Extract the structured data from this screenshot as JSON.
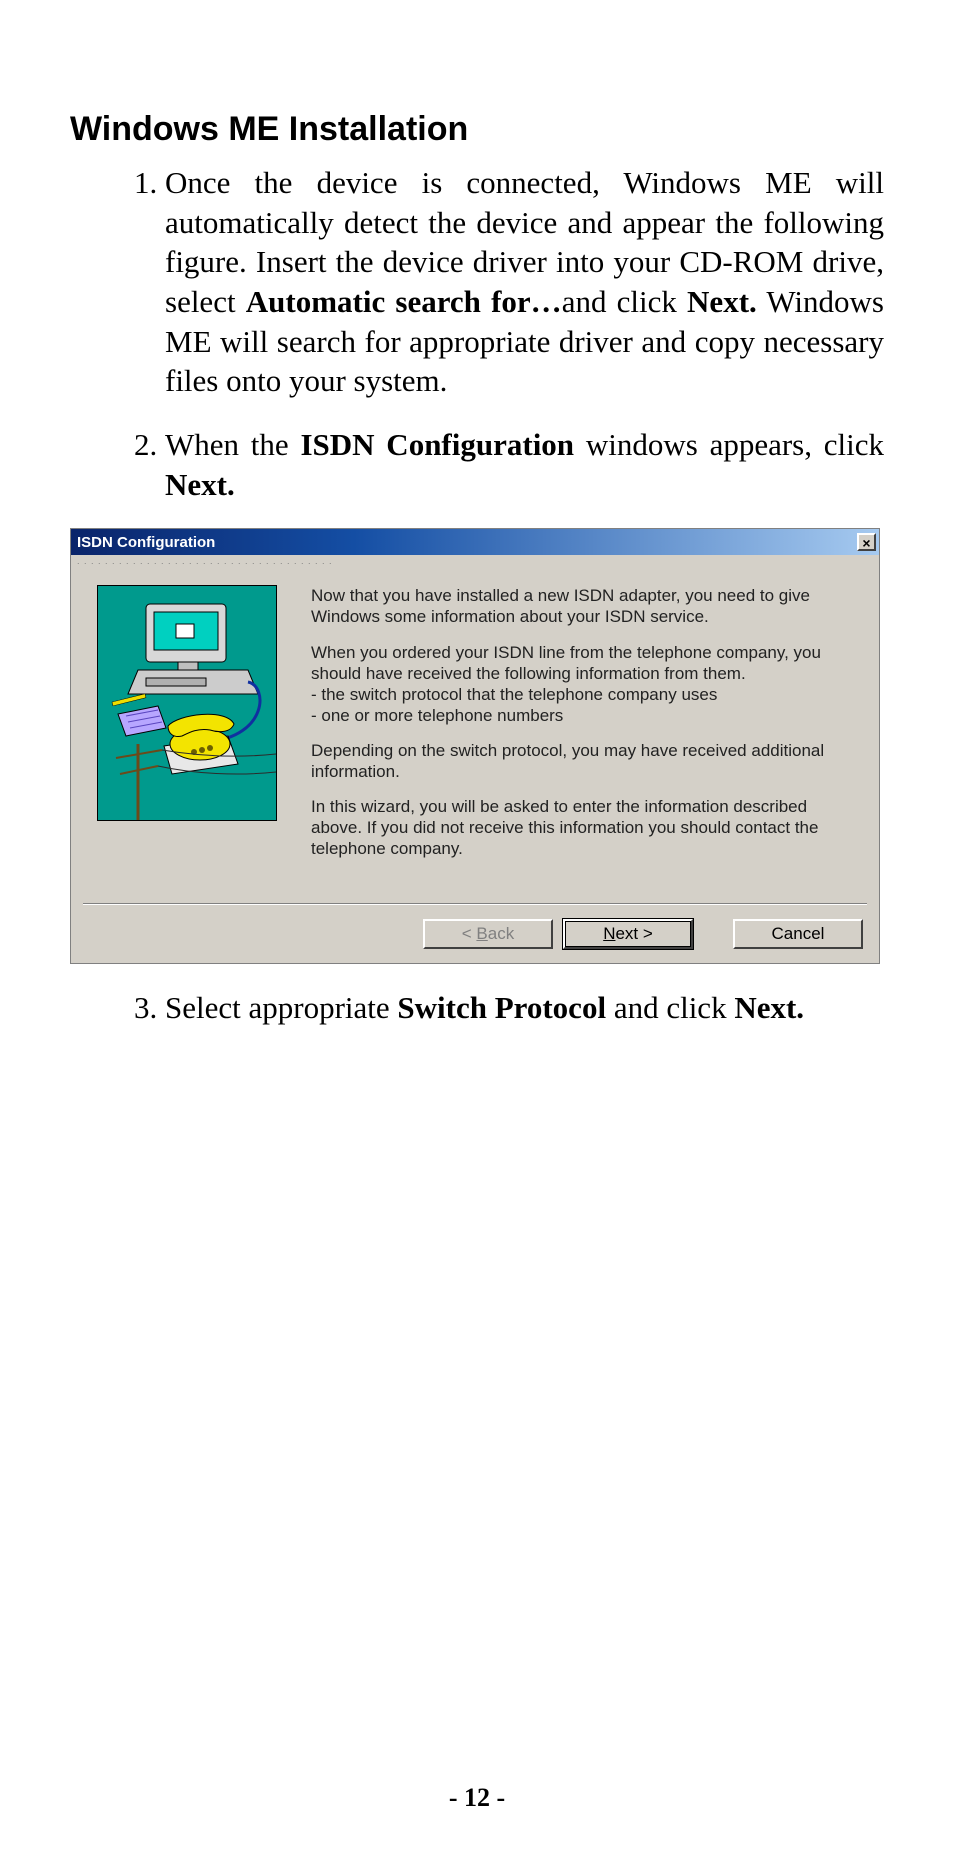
{
  "heading": "Windows ME Installation",
  "steps": {
    "s1": {
      "p1": "Once the device is connected, Windows ME will automatically detect the device and appear the following figure.  Insert the device driver into your CD-ROM drive, select ",
      "b1": "Automatic search for…",
      "p2": "and click ",
      "b2": "Next.",
      "p3": "  Windows ME will search for appropriate driver and copy necessary files onto your system."
    },
    "s2": {
      "p1": "When the ",
      "b1": "ISDN Configuration",
      "p2": " windows appears, click ",
      "b2": "Next."
    },
    "s3": {
      "p1": "Select appropriate ",
      "b1": "Switch Protocol",
      "p2": " and click ",
      "b2": "Next."
    }
  },
  "dialog": {
    "title": "ISDN Configuration",
    "close_x": "×",
    "msg": {
      "p1": "Now that you have installed a new ISDN adapter, you need to give Windows some information about your ISDN service.",
      "block2": {
        "l1": "When you ordered your ISDN line from the telephone company, you should have received the following information from them.",
        "l2": "- the switch protocol that the telephone company uses",
        "l3": "- one or more telephone numbers"
      },
      "p3": "Depending on the switch protocol, you may have received additional information.",
      "p4": "In this wizard, you will be asked to enter the information described above.  If you did not receive this information you should contact the telephone company."
    },
    "buttons": {
      "back_pre": "< ",
      "back_u": "B",
      "back_post": "ack",
      "next_u": "N",
      "next_post": "ext >",
      "cancel": "Cancel"
    }
  },
  "page_number": "- 12 -"
}
